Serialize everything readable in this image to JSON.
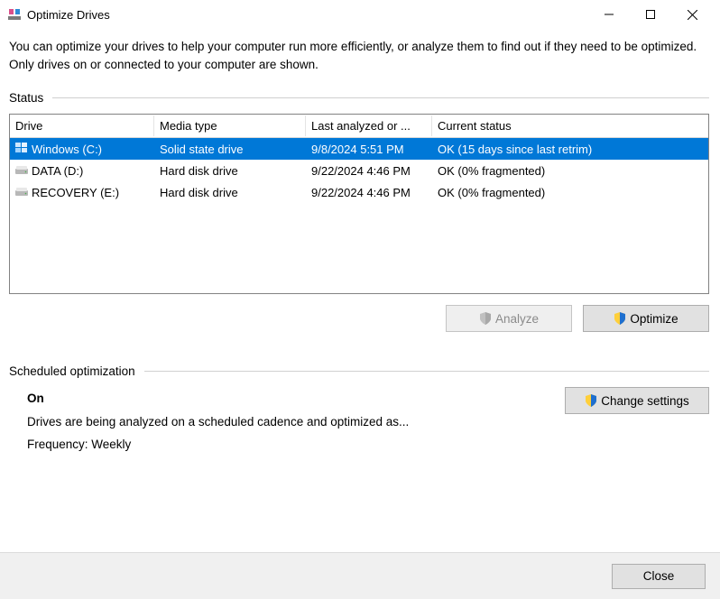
{
  "titlebar": {
    "title": "Optimize Drives"
  },
  "description": "You can optimize your drives to help your computer run more efficiently, or analyze them to find out if they need to be optimized. Only drives on or connected to your computer are shown.",
  "status": {
    "section_label": "Status",
    "columns": {
      "drive": "Drive",
      "media": "Media type",
      "last": "Last analyzed or ...",
      "status": "Current status"
    },
    "rows": [
      {
        "drive": "Windows (C:)",
        "media": "Solid state drive",
        "last": "9/8/2024 5:51 PM",
        "status": "OK (15 days since last retrim)",
        "selected": true,
        "icon": "windows"
      },
      {
        "drive": "DATA (D:)",
        "media": "Hard disk drive",
        "last": "9/22/2024 4:46 PM",
        "status": "OK (0% fragmented)",
        "selected": false,
        "icon": "hdd"
      },
      {
        "drive": "RECOVERY (E:)",
        "media": "Hard disk drive",
        "last": "9/22/2024 4:46 PM",
        "status": "OK (0% fragmented)",
        "selected": false,
        "icon": "hdd"
      }
    ]
  },
  "buttons": {
    "analyze": "Analyze",
    "optimize": "Optimize",
    "change_settings": "Change settings",
    "close": "Close"
  },
  "scheduled": {
    "section_label": "Scheduled optimization",
    "on_label": "On",
    "desc": "Drives are being analyzed on a scheduled cadence and optimized as...",
    "frequency": "Frequency: Weekly"
  }
}
